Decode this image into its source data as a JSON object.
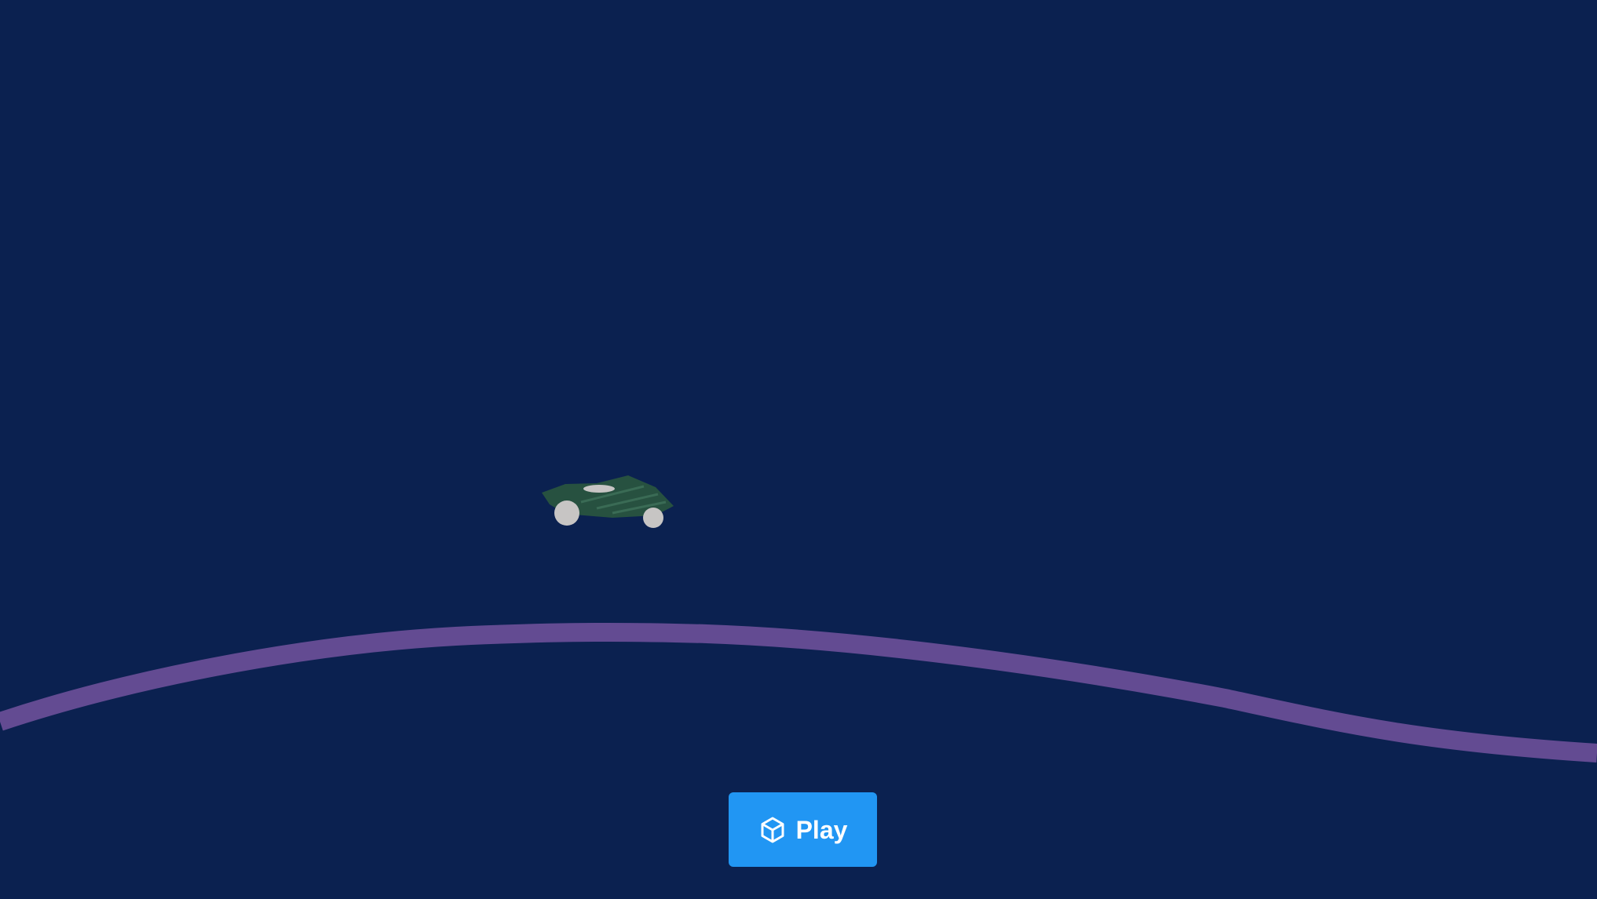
{
  "game": {
    "background_color": "#0b2150",
    "track_color": "#634b92",
    "car_body_color": "#275140",
    "car_wheel_color": "#c7c5c4"
  },
  "play_button": {
    "label": "Play",
    "icon": "unity-logo-icon",
    "color": "#2196f3"
  }
}
